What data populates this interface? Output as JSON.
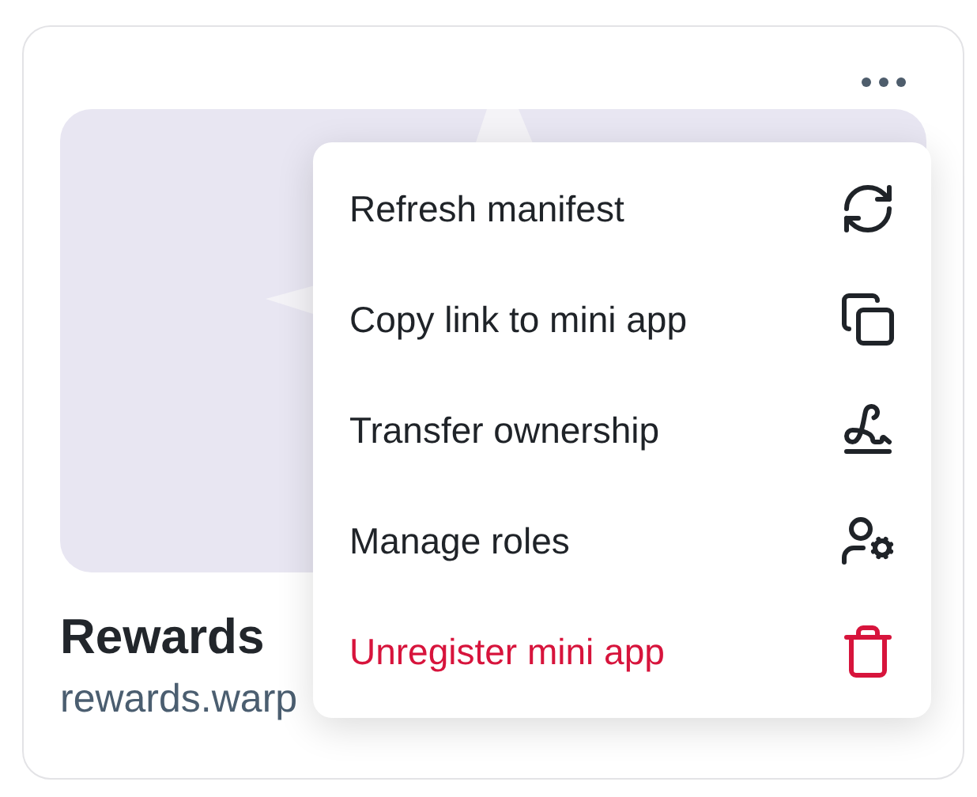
{
  "card": {
    "title": "Rewards",
    "domain": "rewards.warp"
  },
  "menu": {
    "items": [
      {
        "label": "Refresh manifest",
        "kind": "normal"
      },
      {
        "label": "Copy link to mini app",
        "kind": "normal"
      },
      {
        "label": "Transfer ownership",
        "kind": "normal"
      },
      {
        "label": "Manage roles",
        "kind": "normal"
      },
      {
        "label": "Unregister mini app",
        "kind": "danger"
      }
    ]
  }
}
